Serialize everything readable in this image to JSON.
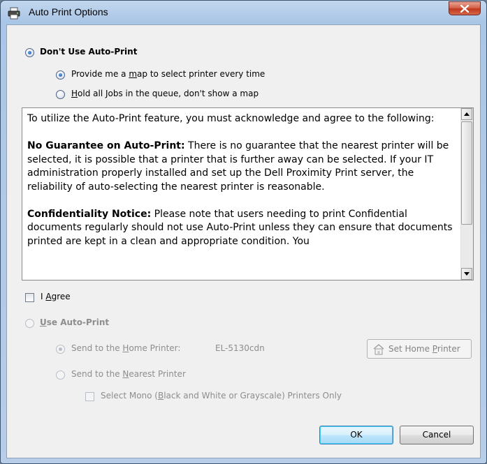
{
  "window": {
    "title": "Auto Print Options",
    "close_icon": "close-icon",
    "app_icon": "printer-icon"
  },
  "options": {
    "dont_use": {
      "label": "Don't Use Auto-Print",
      "selected": true
    },
    "map_every_time": {
      "label_pre": "Provide me a ",
      "label_u": "m",
      "label_post": "ap to select printer every time",
      "selected": true
    },
    "hold_jobs": {
      "label_pre": "",
      "label_u": "H",
      "label_post": "old all Jobs in the queue, don't show a map",
      "selected": false
    }
  },
  "agreement": {
    "intro": "To utilize the Auto-Print feature, you must acknowledge and agree to the following:",
    "guarantee_heading": "No Guarantee on Auto-Print:",
    "guarantee_text": " There is no guarantee that the nearest printer will be selected, it is possible that a printer that is further away can be selected. If your IT administration properly installed and set up the Dell Proximity Print server, the reliability of auto-selecting the nearest printer is reasonable.",
    "confidential_heading": "Confidentiality Notice:",
    "confidential_text": " Please note that users needing to print Confidential documents regularly should not use Auto-Print unless they can ensure that documents printed are kept in a clean and appropriate condition. You"
  },
  "agree": {
    "label_pre": "I ",
    "label_u": "A",
    "label_post": "gree",
    "checked": false
  },
  "auto": {
    "use": {
      "label_pre": "",
      "label_u": "U",
      "label_post": "se Auto-Print",
      "selected": false,
      "enabled": false
    },
    "home": {
      "label_pre": "Send to the ",
      "label_u": "H",
      "label_post": "ome Printer:",
      "printer": "EL-5130cdn",
      "selected": true,
      "enabled": false
    },
    "nearest": {
      "label_pre": "Send to the ",
      "label_u": "N",
      "label_post": "earest Printer",
      "selected": false,
      "enabled": false
    },
    "mono": {
      "label_pre": "Select Mono (",
      "label_u": "B",
      "label_post": "lack and White or Grayscale) Printers Only",
      "checked": false,
      "enabled": false
    },
    "set_home": {
      "label_pre": "Set Home ",
      "label_u": "P",
      "label_post": "rinter",
      "icon": "home-icon"
    }
  },
  "buttons": {
    "ok": "OK",
    "cancel": "Cancel"
  }
}
